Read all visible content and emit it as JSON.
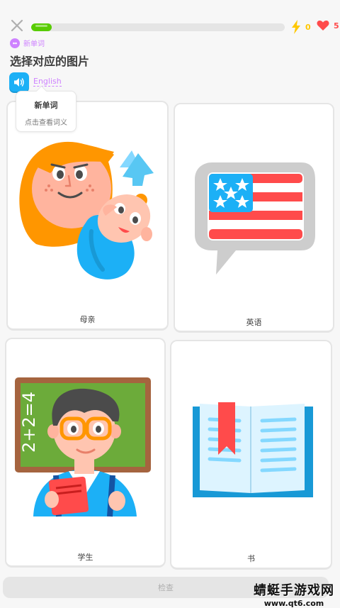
{
  "topbar": {
    "close_icon": "close-icon",
    "progress_percent": 8,
    "energy_count": "0",
    "hearts_count": "5",
    "colors": {
      "progress": "#58cc02",
      "energy": "#ffc800",
      "hearts": "#ff4b4b"
    }
  },
  "challenge": {
    "tag": "新单词",
    "title": "选择对应的图片",
    "speaker_icon": "speaker-icon",
    "word": "English",
    "accent": "#ce82ff"
  },
  "tooltip": {
    "title": "新单词",
    "hint": "点击查看词义"
  },
  "choices": [
    {
      "label": "母亲",
      "image": "mother-with-baby"
    },
    {
      "label": "英语",
      "image": "us-flag-speech-bubble"
    },
    {
      "label": "学生",
      "image": "student-with-book"
    },
    {
      "label": "书",
      "image": "open-book"
    }
  ],
  "footer": {
    "check_label": "检查"
  },
  "watermark": {
    "line1": "蜻蜓手游戏网",
    "line2": "www.qt6.com"
  }
}
